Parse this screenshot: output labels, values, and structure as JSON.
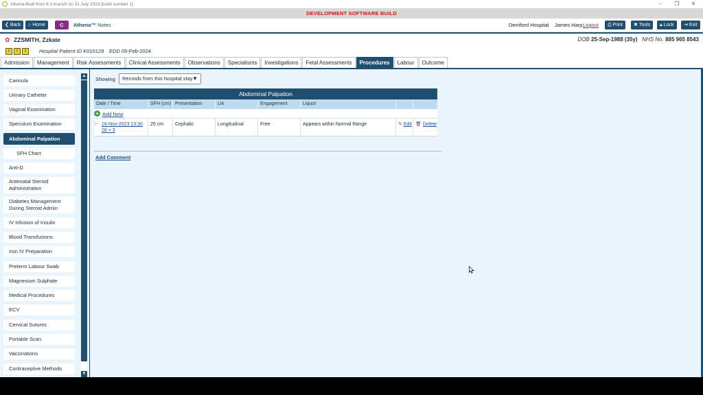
{
  "window": {
    "title": "Athena-Built from 6.1 branch on 31 July 2023 [build number 1]",
    "banner": "DEVELOPMENT SOFTWARE BUILD"
  },
  "toolbar": {
    "back": "Back",
    "home": "Home",
    "c": "C",
    "brand": "Athena™",
    "brand_suffix": "Notes",
    "hospital": "Derriford Hospital",
    "user": "James Harp",
    "logout": "Logout",
    "print": "Print",
    "tools": "Tools",
    "lock": "Lock",
    "exit": "Exit"
  },
  "patient": {
    "name": "ZZSMITH, Zzkate",
    "dob_label": "DOB",
    "dob": "25-Sep-1988 (35y)",
    "nhs_label": "NHS No.",
    "nhs": "885 965 8543",
    "alerts": [
      "!",
      "!",
      "!"
    ],
    "hpid_label": "Hospital Patient ID",
    "hpid": "K010129",
    "edd_label": "EDD",
    "edd": "05-Feb-2024"
  },
  "tabs": [
    "Admission",
    "Management",
    "Risk Assessments",
    "Clinical Assessments",
    "Observations",
    "Specialisms",
    "Investigations",
    "Fetal Assessments",
    "Procedures",
    "Labour",
    "Outcome"
  ],
  "active_tab": "Procedures",
  "sidebar": {
    "items": [
      "Cannula",
      "Urinary Catheter",
      "Vaginal Examination",
      "Speculum Examination",
      "Abdominal Palpation",
      "SFH Chart",
      "Anti-D",
      "Antenatal Steroid Administration",
      "Diabetes Management During Steroid Admin",
      "IV Infusion of Insulin",
      "Blood Transfusions",
      "Iron IV Preparation",
      "Preterm Labour Swab",
      "Magnesium Sulphate",
      "Medical Procedures",
      "ECV",
      "Cervical Sutures",
      "Portable Scan",
      "Vaccinations",
      "Contraceptive Methods"
    ],
    "active": "Abdominal Palpation"
  },
  "filter": {
    "label": "Showing",
    "value": "Records from this hospital stay"
  },
  "panel": {
    "title": "Abdominal Palpation",
    "columns": [
      "Date / Time",
      "SFH (cm)",
      "Presentation",
      "Lie",
      "Engagement",
      "Liquor"
    ],
    "add_new": "Add New",
    "rows": [
      {
        "datetime": "16-Nov-2023 13:30",
        "gestation": "28 + 3",
        "sfh": "25 cm",
        "presentation": "Cephalic",
        "lie": "Longitudinal",
        "engagement": "Free",
        "liquor": "Appears within Normal Range",
        "edit": "Edit",
        "delete": "Delete"
      }
    ]
  },
  "add_comment": "Add Comment"
}
